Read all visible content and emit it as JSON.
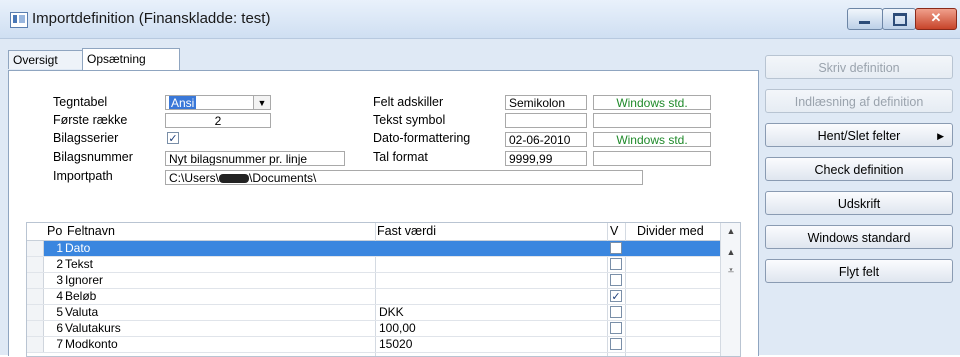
{
  "window": {
    "title": "Importdefinition (Finanskladde: test)",
    "caption": {
      "minimize_glyph": "",
      "maximize_glyph": "",
      "close_glyph": "✕"
    }
  },
  "tabs": [
    {
      "label": "Oversigt"
    },
    {
      "label": "Opsætning"
    }
  ],
  "form": {
    "tegntabel_label": "Tegntabel",
    "tegntabel_value": "Ansi",
    "forste_raekke_label": "Første række",
    "forste_raekke_value": "2",
    "bilagsserier_label": "Bilagsserier",
    "bilagsserier_checked": "✓",
    "bilagsnummer_label": "Bilagsnummer",
    "bilagsnummer_value": "Nyt bilagsnummer pr. linje",
    "importpath_label": "Importpath",
    "importpath_prefix": "C:\\Users\\",
    "importpath_suffix": "\\Documents\\",
    "felt_adskiller_label": "Felt adskiller",
    "felt_adskiller_value": "Semikolon",
    "felt_adskiller_std": "Windows std.",
    "tekst_symbol_label": "Tekst symbol",
    "tekst_symbol_value": "",
    "dato_format_label": "Dato-formattering",
    "dato_format_value": "02-06-2010",
    "dato_format_std": "Windows std.",
    "tal_format_label": "Tal format",
    "tal_format_value": "9999,99"
  },
  "grid": {
    "headers": {
      "po": "Po",
      "feltnavn": "Feltnavn",
      "fast": "Fast værdi",
      "v": "V",
      "divider": "Divider med"
    },
    "rows": [
      {
        "po": "1",
        "name": "Dato",
        "fast": "",
        "v": "",
        "div": ""
      },
      {
        "po": "2",
        "name": "Tekst",
        "fast": "",
        "v": "",
        "div": ""
      },
      {
        "po": "3",
        "name": "Ignorer",
        "fast": "",
        "v": "",
        "div": ""
      },
      {
        "po": "4",
        "name": "Beløb",
        "fast": "",
        "v": "✓",
        "div": ""
      },
      {
        "po": "5",
        "name": "Valuta",
        "fast": "DKK",
        "v": "",
        "div": ""
      },
      {
        "po": "6",
        "name": "Valutakurs",
        "fast": "100,00",
        "v": "",
        "div": ""
      },
      {
        "po": "7",
        "name": "Modkonto",
        "fast": "15020",
        "v": "",
        "div": ""
      }
    ]
  },
  "buttons": {
    "skriv": "Skriv definition",
    "indlaesning": "Indlæsning af definition",
    "hent_slet": "Hent/Slet felter",
    "check": "Check definition",
    "udskrift": "Udskrift",
    "windows_std": "Windows standard",
    "flyt": "Flyt felt"
  }
}
